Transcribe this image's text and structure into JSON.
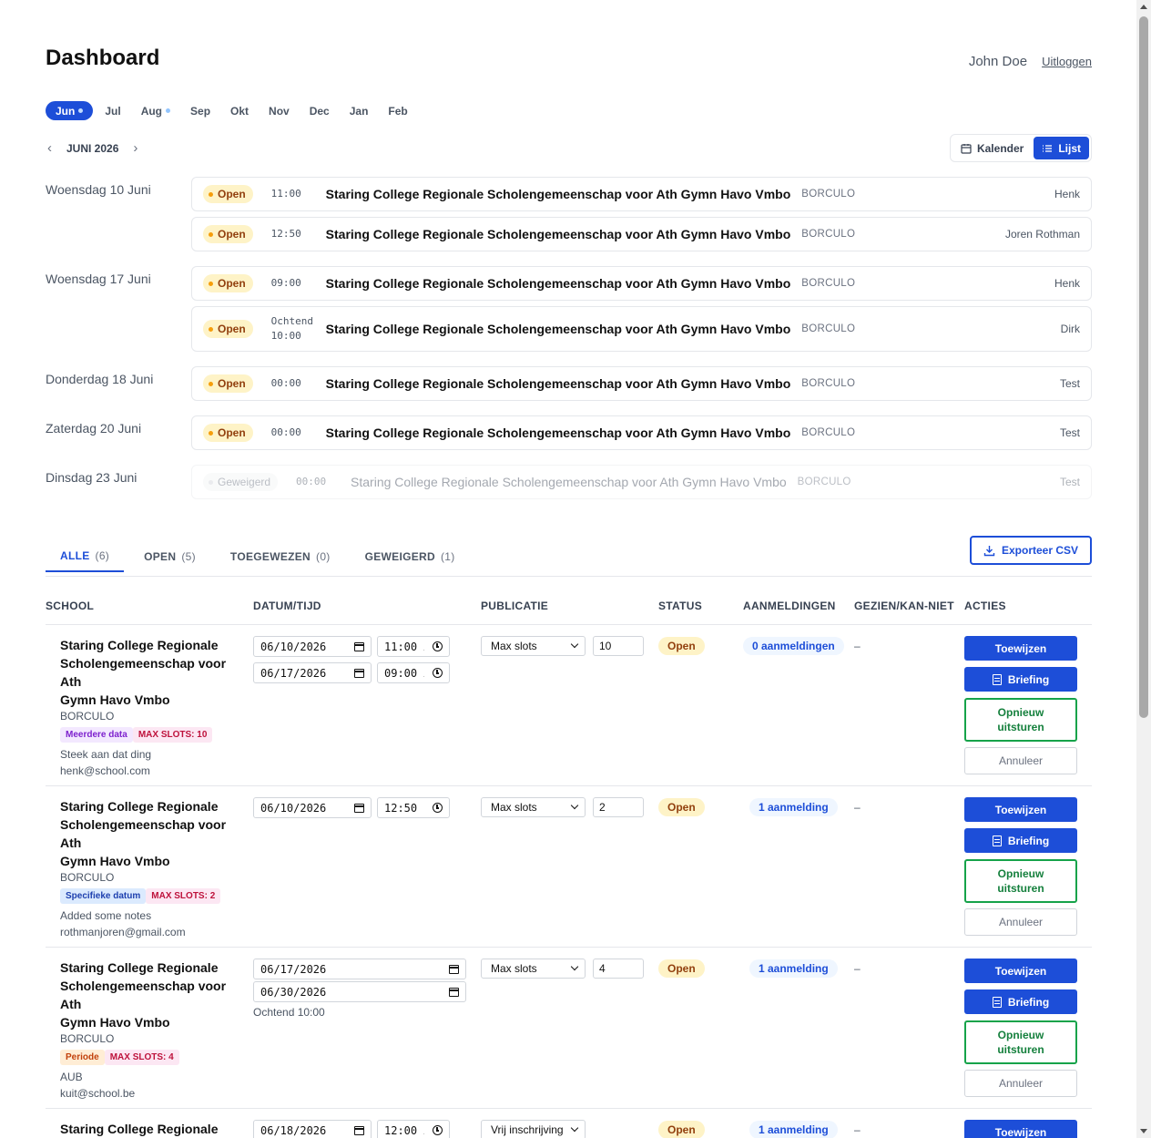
{
  "header": {
    "title": "Dashboard",
    "user_name": "John Doe",
    "logout_label": "Uitloggen"
  },
  "months": [
    {
      "label": "Jun",
      "active": true,
      "dot": true
    },
    {
      "label": "Jul"
    },
    {
      "label": "Aug",
      "dot": true
    },
    {
      "label": "Sep"
    },
    {
      "label": "Okt"
    },
    {
      "label": "Nov"
    },
    {
      "label": "Dec"
    },
    {
      "label": "Jan"
    },
    {
      "label": "Feb"
    }
  ],
  "month_nav": {
    "prev": "‹",
    "current": "JUNI 2026",
    "next": "›"
  },
  "view_toggle": {
    "calendar": "Kalender",
    "list": "Lijst"
  },
  "days": [
    {
      "label": "Woensdag 10 Juni",
      "events": [
        {
          "status": "Open",
          "time": "11:00",
          "school": "Staring College Regionale Scholengemeenschap voor Ath Gymn Havo Vmbo",
          "city": "BORCULO",
          "person": "Henk"
        },
        {
          "status": "Open",
          "time": "12:50",
          "school": "Staring College Regionale Scholengemeenschap voor Ath Gymn Havo Vmbo",
          "city": "BORCULO",
          "person": "Joren Rothman"
        }
      ]
    },
    {
      "label": "Woensdag 17 Juni",
      "events": [
        {
          "status": "Open",
          "time": "09:00",
          "school": "Staring College Regionale Scholengemeenschap voor Ath Gymn Havo Vmbo",
          "city": "BORCULO",
          "person": "Henk"
        },
        {
          "status": "Open",
          "time_prefix": "Ochtend",
          "time": "10:00",
          "school": "Staring College Regionale Scholengemeenschap voor Ath Gymn Havo Vmbo",
          "city": "BORCULO",
          "person": "Dirk"
        }
      ]
    },
    {
      "label": "Donderdag 18 Juni",
      "events": [
        {
          "status": "Open",
          "time": "00:00",
          "school": "Staring College Regionale Scholengemeenschap voor Ath Gymn Havo Vmbo",
          "city": "BORCULO",
          "person": "Test"
        }
      ]
    },
    {
      "label": "Zaterdag 20 Juni",
      "events": [
        {
          "status": "Open",
          "time": "00:00",
          "school": "Staring College Regionale Scholengemeenschap voor Ath Gymn Havo Vmbo",
          "city": "BORCULO",
          "person": "Test"
        }
      ]
    },
    {
      "label": "Dinsdag 23 Juni",
      "events": [
        {
          "status": "Geweigerd",
          "time": "00:00",
          "school": "Staring College Regionale Scholengemeenschap voor Ath Gymn Havo Vmbo",
          "city": "BORCULO",
          "person": "Test"
        }
      ]
    }
  ],
  "tabs": [
    {
      "label": "ALLE",
      "count": "(6)",
      "active": true
    },
    {
      "label": "OPEN",
      "count": "(5)"
    },
    {
      "label": "TOEGEWEZEN",
      "count": "(0)"
    },
    {
      "label": "GEWEIGERD",
      "count": "(1)"
    }
  ],
  "export_label": "Exporteer CSV",
  "table": {
    "headers": [
      "SCHOOL",
      "DATUM/TIJD",
      "PUBLICATIE",
      "STATUS",
      "AANMELDINGEN",
      "GEZIEN/KAN-NIET",
      "ACTIES"
    ],
    "actions": {
      "assign": "Toewijzen",
      "briefing": "Briefing",
      "resend_1": "Opnieuw",
      "resend_2": "uitsturen",
      "cancel": "Annuleer"
    },
    "rows": [
      {
        "school_lines": [
          "Staring College Regionale",
          "Scholengemeenschap voor Ath",
          "Gymn Havo Vmbo"
        ],
        "city": "BORCULO",
        "tag1": "Meerdere data",
        "tag2": "MAX SLOTS: 10",
        "note": "Steek aan dat ding",
        "email": "henk@school.com",
        "date1": "06/10/2026",
        "time1": "11:00 A",
        "date2": "06/17/2026",
        "time2": "09:00 A",
        "publication": "Max slots",
        "slots": "10",
        "status": "Open",
        "signups": "0 aanmeldingen",
        "seen": "–"
      },
      {
        "school_lines": [
          "Staring College Regionale",
          "Scholengemeenschap voor Ath",
          "Gymn Havo Vmbo"
        ],
        "city": "BORCULO",
        "tag1": "Specifieke datum",
        "tag2": "MAX SLOTS: 2",
        "note": "Added some notes",
        "email": "rothmanjoren@gmail.com",
        "date1": "06/10/2026",
        "time1": "12:50 P",
        "publication": "Max slots",
        "slots": "2",
        "status": "Open",
        "signups": "1 aanmelding",
        "seen": "–"
      },
      {
        "school_lines": [
          "Staring College Regionale",
          "Scholengemeenschap voor Ath",
          "Gymn Havo Vmbo"
        ],
        "city": "BORCULO",
        "tag1": "Periode",
        "tag2": "MAX SLOTS: 4",
        "note": "AUB",
        "email": "kuit@school.be",
        "date1": "06/17/2026",
        "date2": "06/30/2026",
        "time_note": "Ochtend 10:00",
        "publication": "Max slots",
        "slots": "4",
        "status": "Open",
        "signups": "1 aanmelding",
        "seen": "–"
      },
      {
        "school_lines": [
          "Staring College Regionale"
        ],
        "date1": "06/18/2026",
        "time1": "12:00 A",
        "publication": "Vrij inschrijving",
        "status": "Open",
        "signups": "1 aanmelding",
        "seen": "–"
      }
    ]
  },
  "colors": {
    "primary": "#1d4ed8",
    "open_bg": "#fef3c7",
    "open_fg": "#92400e",
    "green": "#16a34a"
  }
}
